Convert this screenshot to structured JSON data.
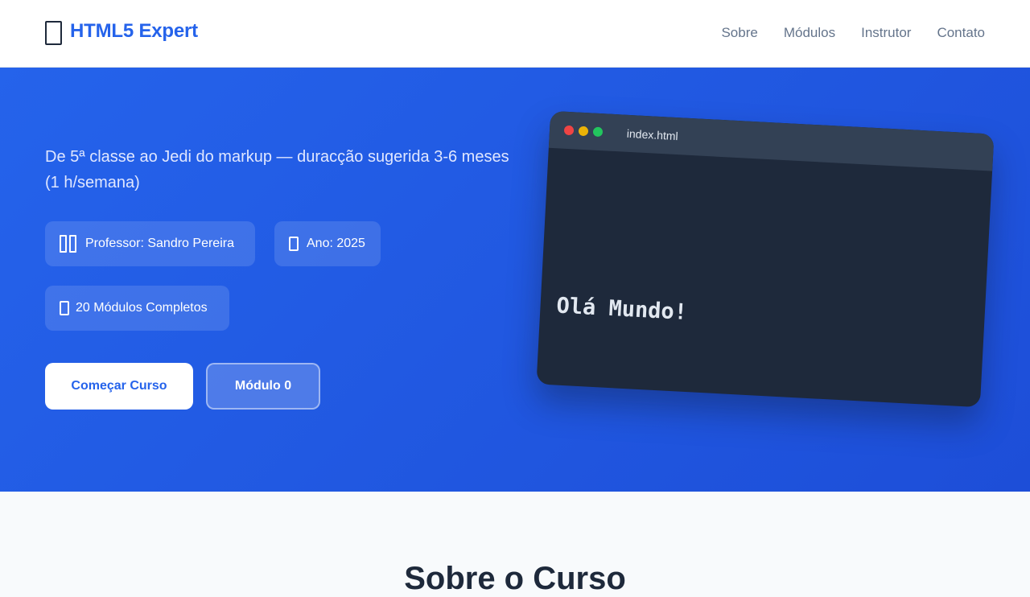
{
  "brand": {
    "title": "HTML5 Expert",
    "icon": "book-icon",
    "color": "#2563eb"
  },
  "nav": {
    "items": [
      "Sobre",
      "Módulos",
      "Instrutor",
      "Contato"
    ]
  },
  "hero": {
    "subtitle": "De 5ª classe ao Jedi do markup — duracção sugerida 3-6 meses (1 h/semana)",
    "chips": [
      {
        "icon": "teacher-icon",
        "label": "Professor: Sandro Pereira"
      },
      {
        "icon": "calendar-icon",
        "label": "Ano: 2025"
      },
      {
        "icon": "modules-icon",
        "label": "20 Módulos Completos"
      }
    ],
    "buttons": {
      "primary": "Começar Curso",
      "secondary": "Módulo 0"
    },
    "gradient": [
      "#2563eb",
      "#1d4ed8"
    ]
  },
  "editor": {
    "filename": "index.html",
    "code": "Olá Mundo!"
  },
  "about": {
    "title": "Sobre o Curso"
  }
}
